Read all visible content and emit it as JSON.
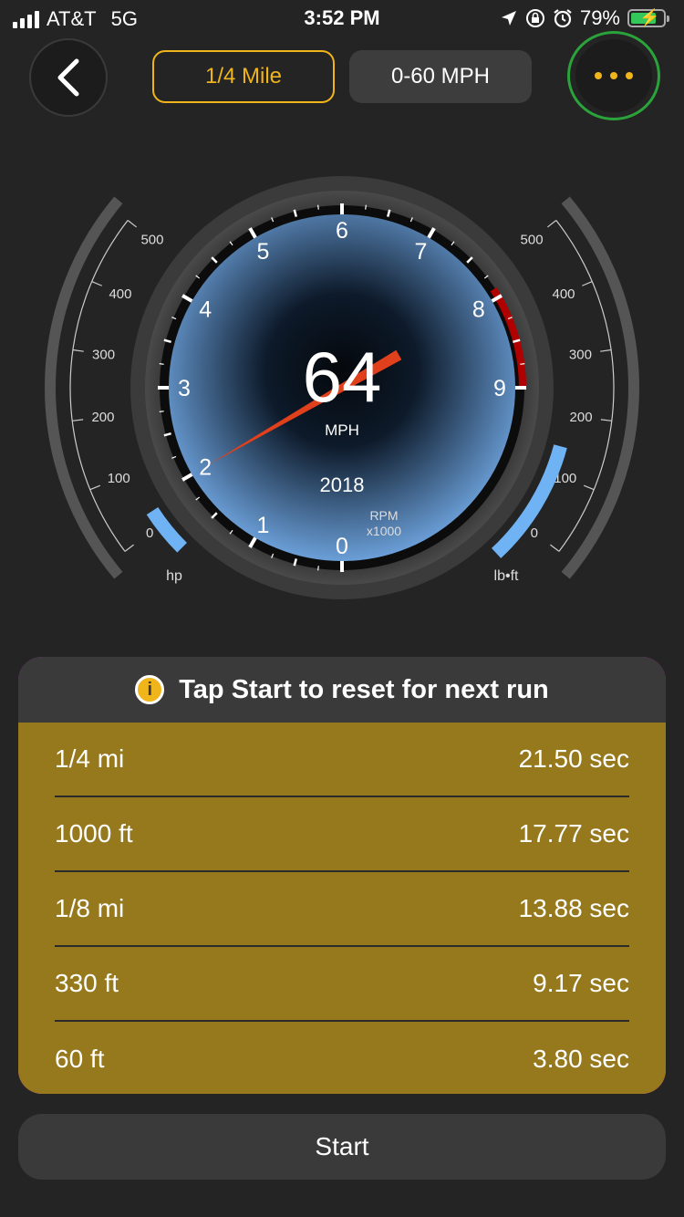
{
  "status_bar": {
    "carrier": "AT&T",
    "network": "5G",
    "time": "3:52 PM",
    "battery": "79%",
    "battery_level": 0.79,
    "icons": [
      "signal-icon",
      "location-icon",
      "orientation-lock-icon",
      "alarm-icon",
      "battery-charging-icon"
    ]
  },
  "header": {
    "back_icon": "chevron-left-icon",
    "tabs": [
      {
        "label": "1/4 Mile",
        "active": true
      },
      {
        "label": "0-60 MPH",
        "active": false
      }
    ],
    "more_icon": "ellipsis-icon"
  },
  "gauge": {
    "speed": "64",
    "speed_unit": "MPH",
    "year": "2018",
    "rpm_label": "RPM",
    "rpm_multiplier": "x1000",
    "rpm_ticks": [
      "0",
      "1",
      "2",
      "3",
      "4",
      "5",
      "6",
      "7",
      "8",
      "9"
    ],
    "needle_rpm": 2,
    "hp_scale": [
      "0",
      "100",
      "200",
      "300",
      "400",
      "500"
    ],
    "hp_unit": "hp",
    "torque_scale": [
      "0",
      "100",
      "200",
      "300",
      "400",
      "500"
    ],
    "torque_unit": "lb•ft",
    "colors": {
      "accent": "#f1b51c",
      "needle": "#e0401c",
      "redline": "#b00000",
      "gauge_bar": "#6fb3f4",
      "dial_edge": "#6b9fd8"
    }
  },
  "results": {
    "info_icon": "info-icon",
    "message": "Tap Start to reset for next run",
    "rows": [
      {
        "label": "1/4 mi",
        "value": "21.50 sec"
      },
      {
        "label": "1000 ft",
        "value": "17.77 sec"
      },
      {
        "label": "1/8 mi",
        "value": "13.88 sec"
      },
      {
        "label": "330 ft",
        "value": "9.17 sec"
      },
      {
        "label": "60 ft",
        "value": "3.80 sec"
      }
    ],
    "colors": {
      "panel": "#97791d",
      "header": "#3a3a3a"
    }
  },
  "start_button": {
    "label": "Start"
  }
}
